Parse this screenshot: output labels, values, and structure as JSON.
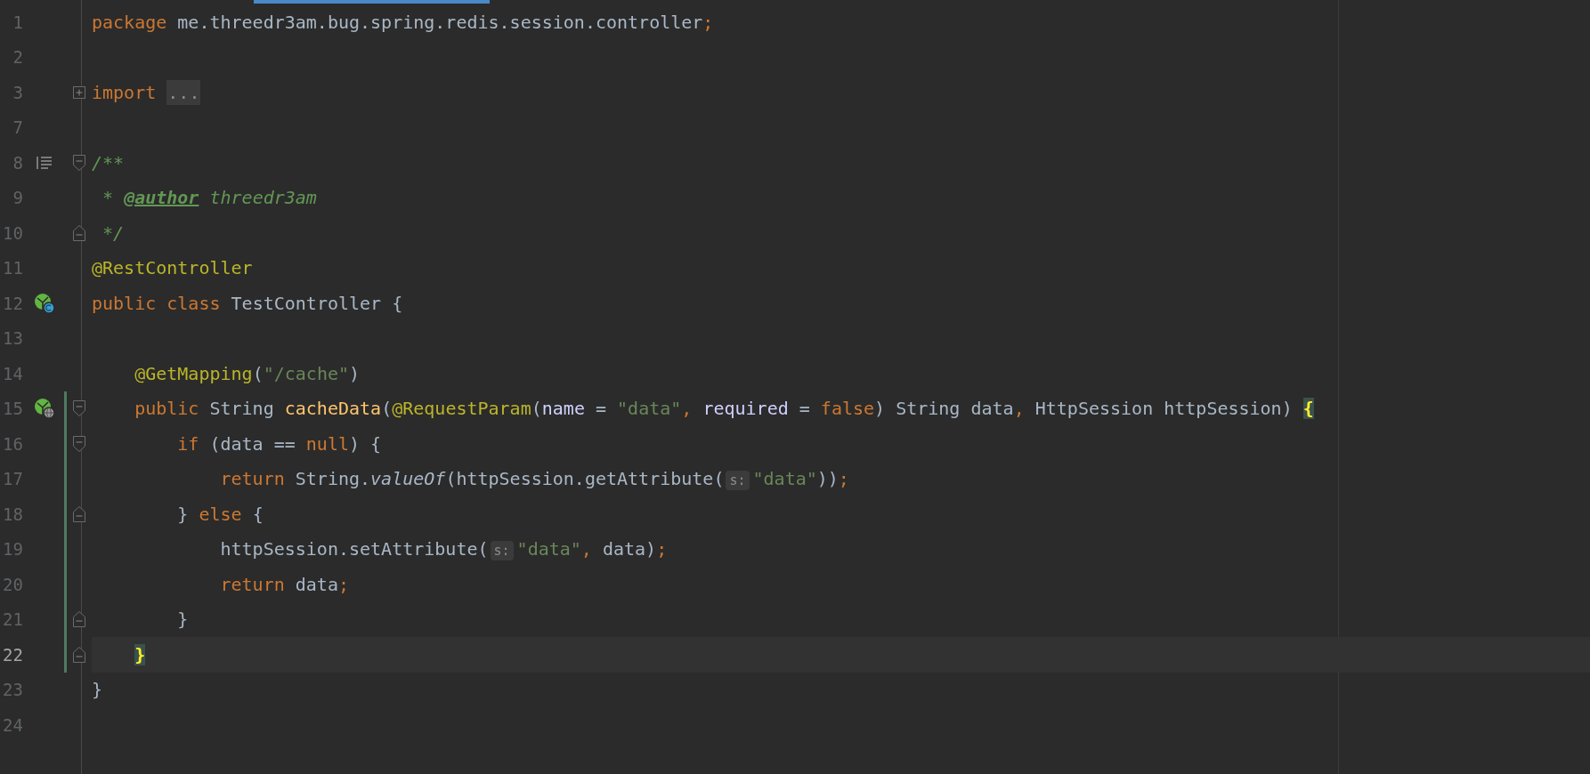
{
  "editor": {
    "lines": [
      {
        "number": "1",
        "current": false,
        "modified": false,
        "tokens": [
          {
            "text": "package ",
            "kind": "keyword"
          },
          {
            "text": "me.threedr3am.bug.spring.redis.session.controller",
            "kind": "plain"
          },
          {
            "text": ";",
            "kind": "keyword"
          }
        ]
      },
      {
        "number": "2",
        "current": false,
        "modified": false
      },
      {
        "number": "3",
        "current": false,
        "modified": false,
        "fold_marker": {
          "kind": "collapsed"
        },
        "tokens": [
          {
            "text": "import ",
            "kind": "keyword"
          },
          {
            "text": "...",
            "kind": "folded"
          }
        ]
      },
      {
        "number": "7",
        "current": false,
        "modified": false
      },
      {
        "number": "8",
        "current": false,
        "modified": false,
        "fold_marker": {
          "kind": "start"
        },
        "gutter_icon": {
          "kind": "doc"
        },
        "tokens": [
          {
            "text": "/**",
            "kind": "comment"
          }
        ]
      },
      {
        "number": "9",
        "current": false,
        "modified": false,
        "tokens": [
          {
            "text": " * ",
            "kind": "comment"
          },
          {
            "text": "@author",
            "kind": "doc_tag"
          },
          {
            "text": " threedr3am",
            "kind": "comment"
          }
        ]
      },
      {
        "number": "10",
        "current": false,
        "modified": false,
        "fold_marker": {
          "kind": "end"
        },
        "tokens": [
          {
            "text": " */",
            "kind": "comment"
          }
        ]
      },
      {
        "number": "11",
        "current": false,
        "modified": false,
        "tokens": [
          {
            "text": "@RestController",
            "kind": "annotation"
          }
        ]
      },
      {
        "number": "12",
        "current": false,
        "modified": false,
        "gutter_icon": {
          "kind": "bean"
        },
        "tokens": [
          {
            "text": "public class ",
            "kind": "keyword"
          },
          {
            "text": "TestController {",
            "kind": "plain"
          }
        ]
      },
      {
        "number": "13",
        "current": false,
        "modified": false
      },
      {
        "number": "14",
        "current": false,
        "modified": false,
        "tokens": [
          {
            "text": "    @GetMapping",
            "kind": "annotation"
          },
          {
            "text": "(",
            "kind": "plain"
          },
          {
            "text": "\"/cache\"",
            "kind": "string"
          },
          {
            "text": ")",
            "kind": "plain"
          }
        ]
      },
      {
        "number": "15",
        "current": false,
        "modified": true,
        "fold_marker": {
          "kind": "start"
        },
        "gutter_icon": {
          "kind": "endpoint"
        },
        "tokens": [
          {
            "text": "    public ",
            "kind": "keyword"
          },
          {
            "text": "String ",
            "kind": "plain"
          },
          {
            "text": "cacheData",
            "kind": "method"
          },
          {
            "text": "(",
            "kind": "plain"
          },
          {
            "text": "@RequestParam",
            "kind": "annotation"
          },
          {
            "text": "(",
            "kind": "plain"
          },
          {
            "text": "name",
            "kind": "attribute"
          },
          {
            "text": " = ",
            "kind": "plain"
          },
          {
            "text": "\"data\"",
            "kind": "string"
          },
          {
            "text": ", ",
            "kind": "keyword"
          },
          {
            "text": "required",
            "kind": "attribute"
          },
          {
            "text": " = ",
            "kind": "plain"
          },
          {
            "text": "false",
            "kind": "keyword"
          },
          {
            "text": ") String data",
            "kind": "plain"
          },
          {
            "text": ", ",
            "kind": "keyword"
          },
          {
            "text": "HttpSession httpSession) ",
            "kind": "plain"
          },
          {
            "text": "{",
            "kind": "brace_match"
          }
        ]
      },
      {
        "number": "16",
        "current": false,
        "modified": true,
        "fold_marker": {
          "kind": "start"
        },
        "tokens": [
          {
            "text": "        if ",
            "kind": "keyword"
          },
          {
            "text": "(data == ",
            "kind": "plain"
          },
          {
            "text": "null",
            "kind": "keyword"
          },
          {
            "text": ") {",
            "kind": "plain"
          }
        ]
      },
      {
        "number": "17",
        "current": false,
        "modified": true,
        "tokens": [
          {
            "text": "            return ",
            "kind": "keyword"
          },
          {
            "text": "String.",
            "kind": "plain"
          },
          {
            "text": "valueOf",
            "kind": "static_method"
          },
          {
            "text": "(httpSession.getAttribute(",
            "kind": "plain"
          },
          {
            "text": "s:",
            "kind": "hint"
          },
          {
            "text": "\"data\"",
            "kind": "string"
          },
          {
            "text": "))",
            "kind": "plain"
          },
          {
            "text": ";",
            "kind": "keyword"
          }
        ]
      },
      {
        "number": "18",
        "current": false,
        "modified": true,
        "fold_marker": {
          "kind": "end"
        },
        "tokens": [
          {
            "text": "        } ",
            "kind": "plain"
          },
          {
            "text": "else ",
            "kind": "keyword"
          },
          {
            "text": "{",
            "kind": "plain"
          }
        ]
      },
      {
        "number": "19",
        "current": false,
        "modified": true,
        "tokens": [
          {
            "text": "            httpSession.setAttribute(",
            "kind": "plain"
          },
          {
            "text": "s:",
            "kind": "hint"
          },
          {
            "text": "\"data\"",
            "kind": "string"
          },
          {
            "text": ", ",
            "kind": "keyword"
          },
          {
            "text": "data)",
            "kind": "plain"
          },
          {
            "text": ";",
            "kind": "keyword"
          }
        ]
      },
      {
        "number": "20",
        "current": false,
        "modified": true,
        "tokens": [
          {
            "text": "            return ",
            "kind": "keyword"
          },
          {
            "text": "data",
            "kind": "plain"
          },
          {
            "text": ";",
            "kind": "keyword"
          }
        ]
      },
      {
        "number": "21",
        "current": false,
        "modified": true,
        "fold_marker": {
          "kind": "end"
        },
        "tokens": [
          {
            "text": "        }",
            "kind": "plain"
          }
        ]
      },
      {
        "number": "22",
        "current": true,
        "modified": true,
        "fold_marker": {
          "kind": "end"
        },
        "tokens": [
          {
            "text": "    }",
            "kind": "brace_match"
          }
        ]
      },
      {
        "number": "23",
        "current": false,
        "modified": false,
        "tokens": [
          {
            "text": "}",
            "kind": "plain"
          }
        ]
      },
      {
        "number": "24",
        "current": false,
        "modified": false
      }
    ]
  }
}
